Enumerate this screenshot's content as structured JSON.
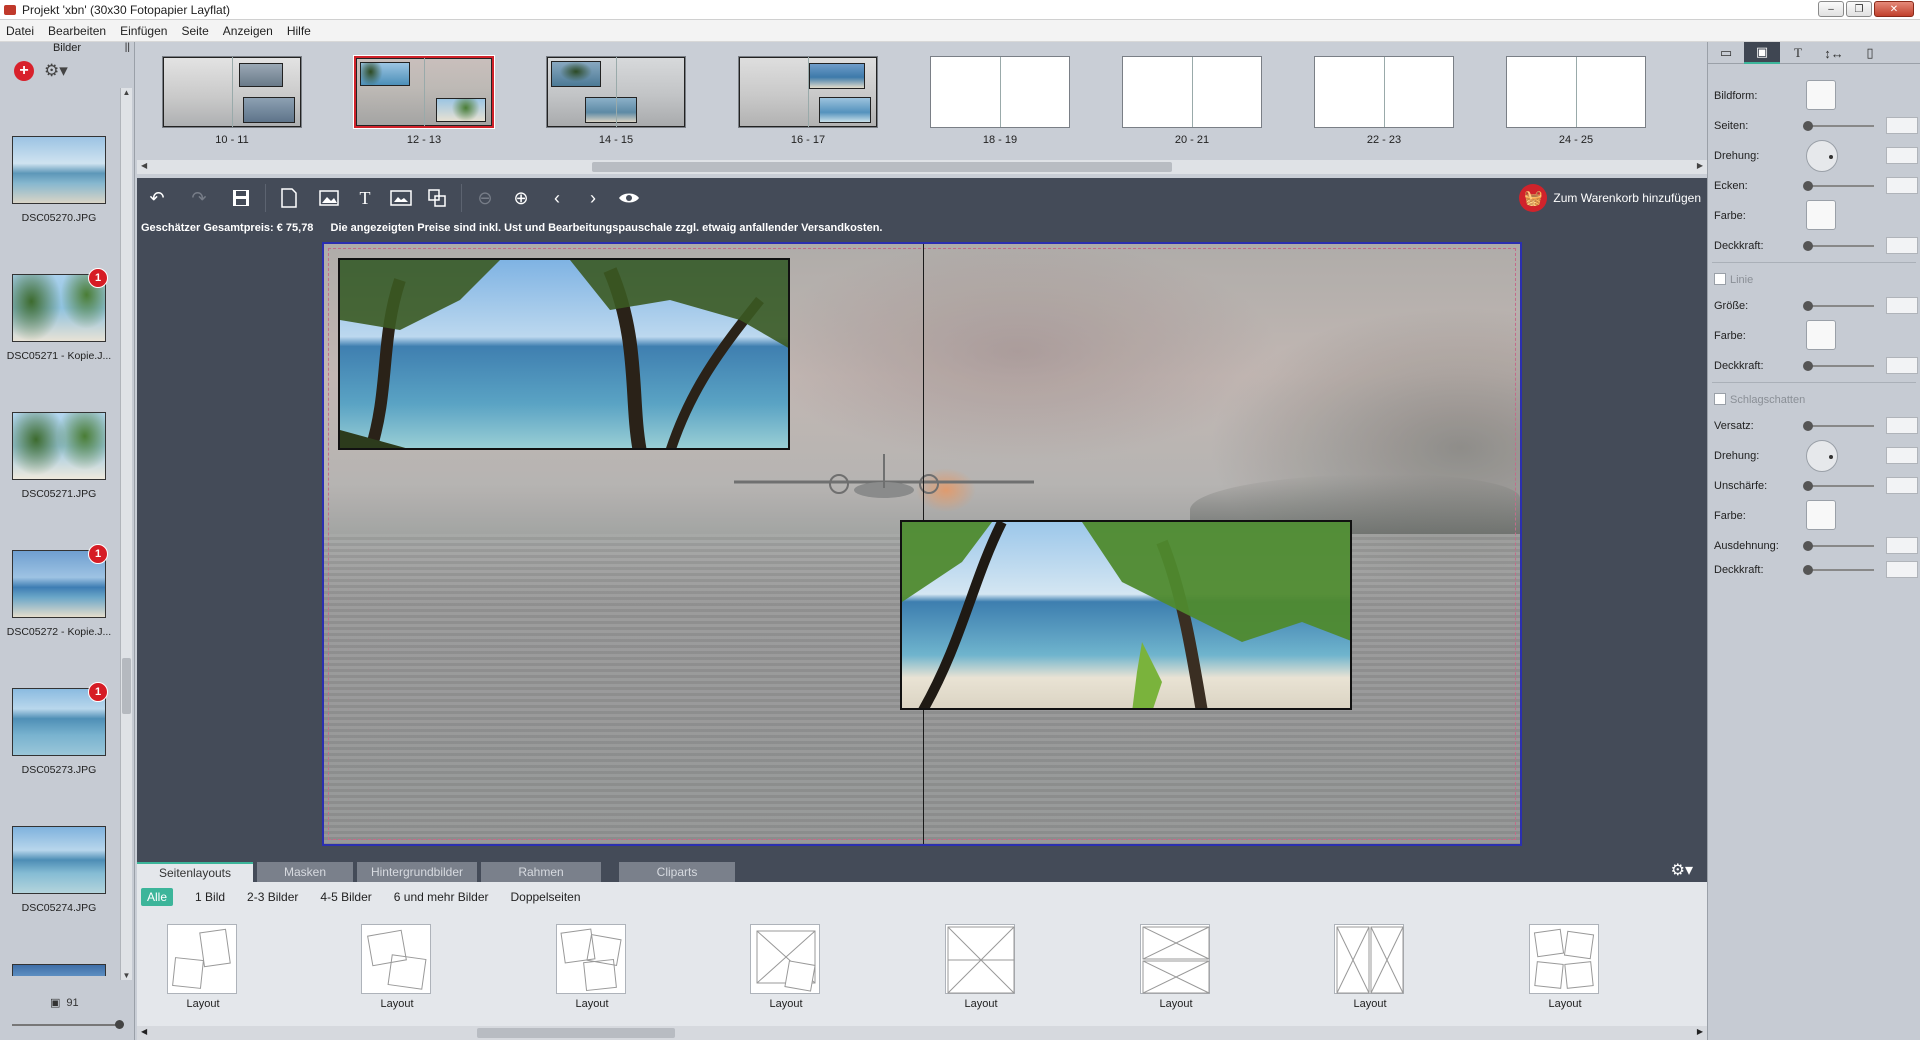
{
  "window": {
    "title": "Projekt 'xbn' (30x30 Fotopapier Layflat)",
    "controls": [
      "–",
      "❐",
      "✕"
    ]
  },
  "menu": [
    "Datei",
    "Bearbeiten",
    "Einfügen",
    "Seite",
    "Anzeigen",
    "Hilfe"
  ],
  "left_panel": {
    "header": "Bilder",
    "add_icon": "plus-icon",
    "settings_icon": "gear-icon",
    "images": [
      {
        "name": "DSC05270.JPG",
        "badge": ""
      },
      {
        "name": "DSC05271 - Kopie.J...",
        "badge": "1"
      },
      {
        "name": "DSC05271.JPG",
        "badge": ""
      },
      {
        "name": "DSC05272 - Kopie.J...",
        "badge": "1"
      },
      {
        "name": "DSC05273.JPG",
        "badge": "1"
      },
      {
        "name": "DSC05274.JPG",
        "badge": ""
      },
      {
        "name": "",
        "badge": ""
      }
    ],
    "count": "91"
  },
  "pages": [
    {
      "label": "10 - 11"
    },
    {
      "label": "12 - 13",
      "selected": true
    },
    {
      "label": "14 - 15"
    },
    {
      "label": "16 - 17"
    },
    {
      "label": "18 - 19"
    },
    {
      "label": "20 - 21"
    },
    {
      "label": "22 - 23"
    },
    {
      "label": "24 - 25"
    }
  ],
  "toolbar": {
    "undo_icon": "undo-icon",
    "redo_icon": "redo-icon",
    "save_icon": "save-icon",
    "page_icon": "page-icon",
    "image_icon": "image-icon",
    "text_icon": "text-icon",
    "background_icon": "background-icon",
    "swap_icon": "swap-icon",
    "zoom_out_icon": "zoom-out-icon",
    "zoom_in_icon": "zoom-in-icon",
    "prev_icon": "chevron-left-icon",
    "next_icon": "chevron-right-icon",
    "preview_icon": "eye-icon",
    "cart_label": "Zum Warenkorb hinzufügen"
  },
  "price": {
    "estimate": "Geschätzer Gesamtpreis: € 75,78",
    "note": "Die angezeigten Preise sind inkl. Ust und Bearbeitungspauschale zzgl. etwaig anfallender Versandkosten."
  },
  "bottom": {
    "tabs": [
      "Seitenlayouts",
      "Masken",
      "Hintergrundbilder",
      "Rahmen",
      "Cliparts"
    ],
    "active_tab": "Seitenlayouts",
    "filters": [
      "Alle",
      "1 Bild",
      "2-3 Bilder",
      "4-5 Bilder",
      "6 und mehr Bilder",
      "Doppelseiten"
    ],
    "active_filter": "Alle",
    "layouts": [
      "Layout",
      "Layout",
      "Layout",
      "Layout",
      "Layout",
      "Layout",
      "Layout",
      "Layout"
    ]
  },
  "right_panel": {
    "tabs": [
      "frame-icon",
      "image-icon",
      "text-icon",
      "resize-icon",
      "page-icon"
    ],
    "active_tab": "image-icon",
    "props": {
      "bildform": "Bildform:",
      "seiten": "Seiten:",
      "drehung": "Drehung:",
      "ecken": "Ecken:",
      "farbe": "Farbe:",
      "deckkraft": "Deckkraft:",
      "linie": "Linie",
      "groesse": "Größe:",
      "farbe2": "Farbe:",
      "deckkraft2": "Deckkraft:",
      "schlagschatten": "Schlagschatten",
      "versatz": "Versatz:",
      "drehung2": "Drehung:",
      "unschaerfe": "Unschärfe:",
      "farbe3": "Farbe:",
      "ausdehnung": "Ausdehnung:",
      "deckkraft3": "Deckkraft:"
    }
  },
  "colors": {
    "accent": "#3cb59a",
    "brand_red": "#d0232b",
    "editor_bg": "#444b58"
  }
}
